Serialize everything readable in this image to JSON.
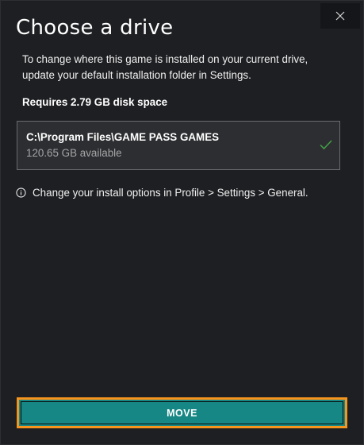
{
  "dialog": {
    "title": "Choose a drive",
    "description": "To change where this game is installed on your current drive, update your default installation folder in Settings.",
    "requires": "Requires 2.79 GB disk space",
    "close_icon": "close-icon"
  },
  "drive": {
    "path": "C:\\Program Files\\GAME PASS GAMES",
    "available": "120.65 GB available",
    "selected": true,
    "check_icon": "checkmark-icon",
    "check_color": "#43a047"
  },
  "info": {
    "icon": "info-icon",
    "text": "Change your install options in Profile > Settings > General."
  },
  "actions": {
    "move_label": "MOVE",
    "move_color": "#168784",
    "focus_color": "#f7941d"
  }
}
